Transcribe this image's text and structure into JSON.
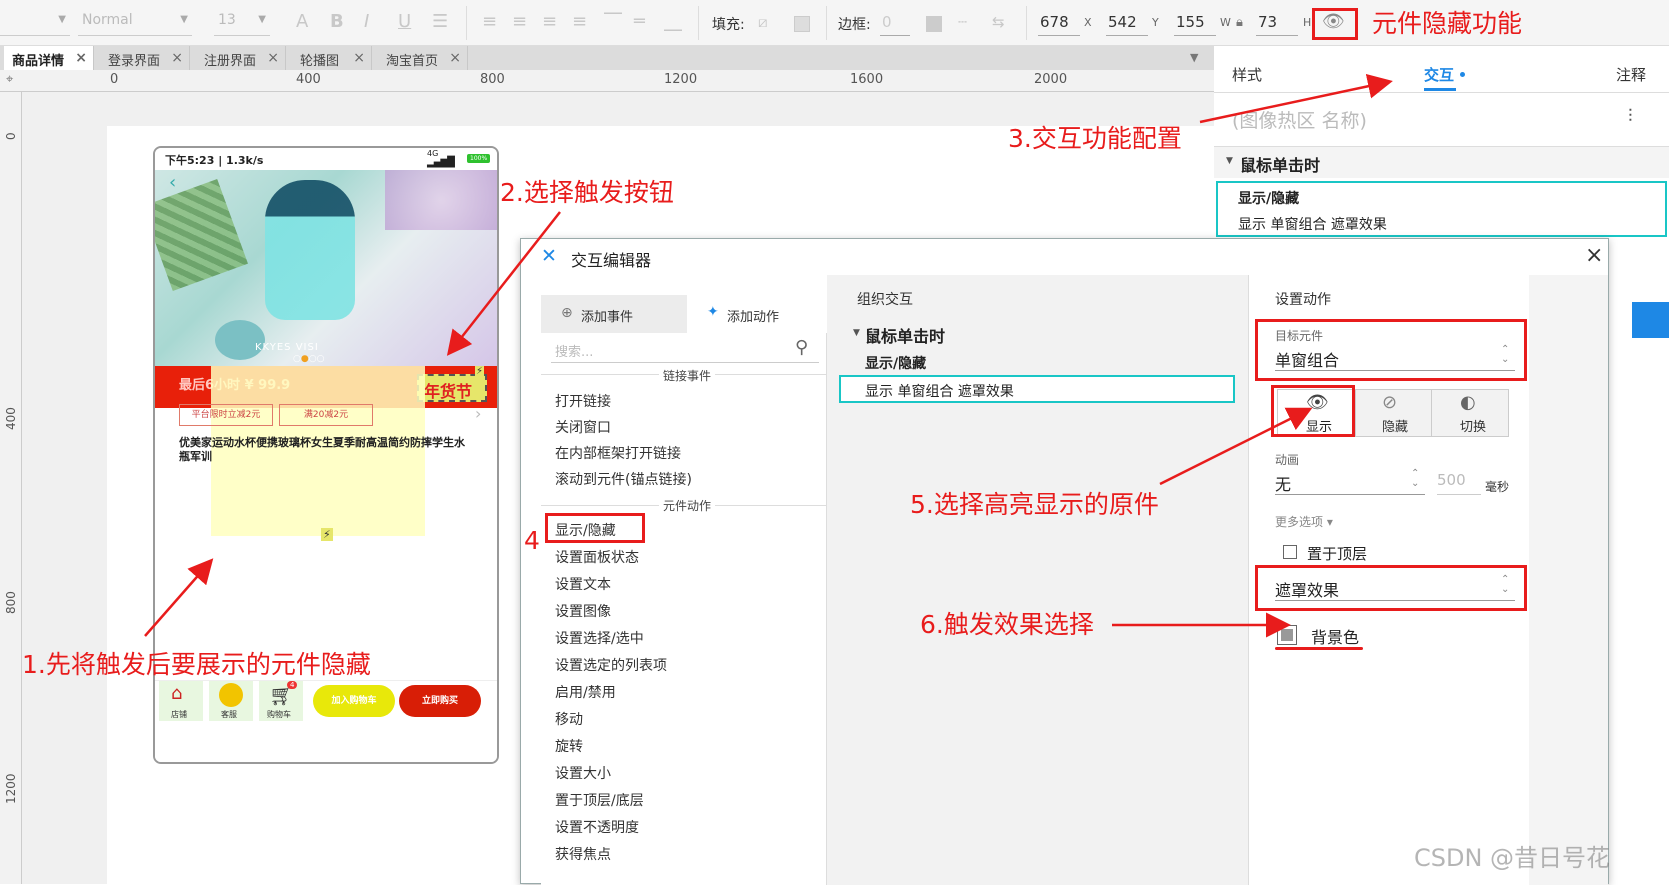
{
  "toolbar": {
    "font_family": "Normal",
    "font_size": "13",
    "fill_label": "填充:",
    "border_label": "边框:",
    "border_value": "0",
    "x_value": "678",
    "x_unit": "X",
    "y_value": "542",
    "y_unit": "Y",
    "w_value": "155",
    "w_unit": "W",
    "h_value": "73",
    "h_unit": "H"
  },
  "tabs": [
    {
      "label": "商品详情",
      "active": true
    },
    {
      "label": "登录界面"
    },
    {
      "label": "注册界面"
    },
    {
      "label": "轮播图"
    },
    {
      "label": "淘宝首页"
    }
  ],
  "ruler": {
    "h": [
      "0",
      "400",
      "800",
      "1200",
      "1600",
      "2000"
    ],
    "v": [
      "0",
      "400",
      "800",
      "1200"
    ]
  },
  "phone": {
    "status_time": "下午5:23 | 1.3k/s",
    "network": "4G",
    "battery": "100%",
    "watermark": "KKYES VISI",
    "price_text": "最后6小时 ¥ 99.9",
    "festival_badge": "年货节",
    "coupon1": "平台限时立减2元",
    "coupon2": "满20减2元",
    "product_title": "优美家运动水杯便携玻璃杯女生夏季耐高温简约防摔学生水瓶军训",
    "nav_shop": "店铺",
    "nav_service": "客服",
    "nav_cart": "购物车",
    "cart_count": "4",
    "add_cart": "加入购物车",
    "buy_now": "立即购买",
    "lightning": "⚡"
  },
  "inspector": {
    "tabs": [
      "样式",
      "交互",
      "注释"
    ],
    "active_tab": "交互",
    "name_placeholder": "(图像热区 名称)",
    "event_title": "鼠标单击时",
    "case_title": "显示/隐藏",
    "case_action": "显示 单窗组合 遮罩效果"
  },
  "editor": {
    "title": "交互编辑器",
    "tab_add_event": "添加事件",
    "tab_add_action": "添加动作",
    "search_placeholder": "搜索...",
    "link_section": "链接事件",
    "link_items": [
      "打开链接",
      "关闭窗口",
      "在内部框架打开链接",
      "滚动到元件(锚点链接)"
    ],
    "widget_section": "元件动作",
    "widget_items": [
      "显示/隐藏",
      "设置面板状态",
      "设置文本",
      "设置图像",
      "设置选择/选中",
      "设置选定的列表项",
      "启用/禁用",
      "移动",
      "旋转",
      "设置大小",
      "置于顶层/底层",
      "设置不透明度",
      "获得焦点"
    ],
    "organize_title": "组织交互",
    "event_title": "鼠标单击时",
    "case_title": "显示/隐藏",
    "case_action": "显示 单窗组合 遮罩效果",
    "setup_title": "设置动作",
    "target_label": "目标元件",
    "target_value": "单窗组合",
    "vis_show": "显示",
    "vis_hide": "隐藏",
    "vis_toggle": "切换",
    "anim_label": "动画",
    "anim_value": "无",
    "duration_value": "500",
    "duration_unit": "毫秒",
    "more_options": "更多选项 ▾",
    "bring_front": "置于顶层",
    "effect_value": "遮罩效果",
    "bg_color_label": "背景色"
  },
  "annotations": {
    "a0": "元件隐藏功能",
    "a1": "1.先将触发后要展示的元件隐藏",
    "a2": "2.选择触发按钮",
    "a3": "3.交互功能配置",
    "a4": "4",
    "a5": "5.选择高亮显示的原件",
    "a6": "6.触发效果选择"
  },
  "watermark": "CSDN @昔日号花",
  "colors": {
    "annotation_red": "#e81c1c",
    "teal_highlight": "#19c6c6",
    "accent_blue": "#1e88e5",
    "price_bar_red": "#e8200a"
  }
}
